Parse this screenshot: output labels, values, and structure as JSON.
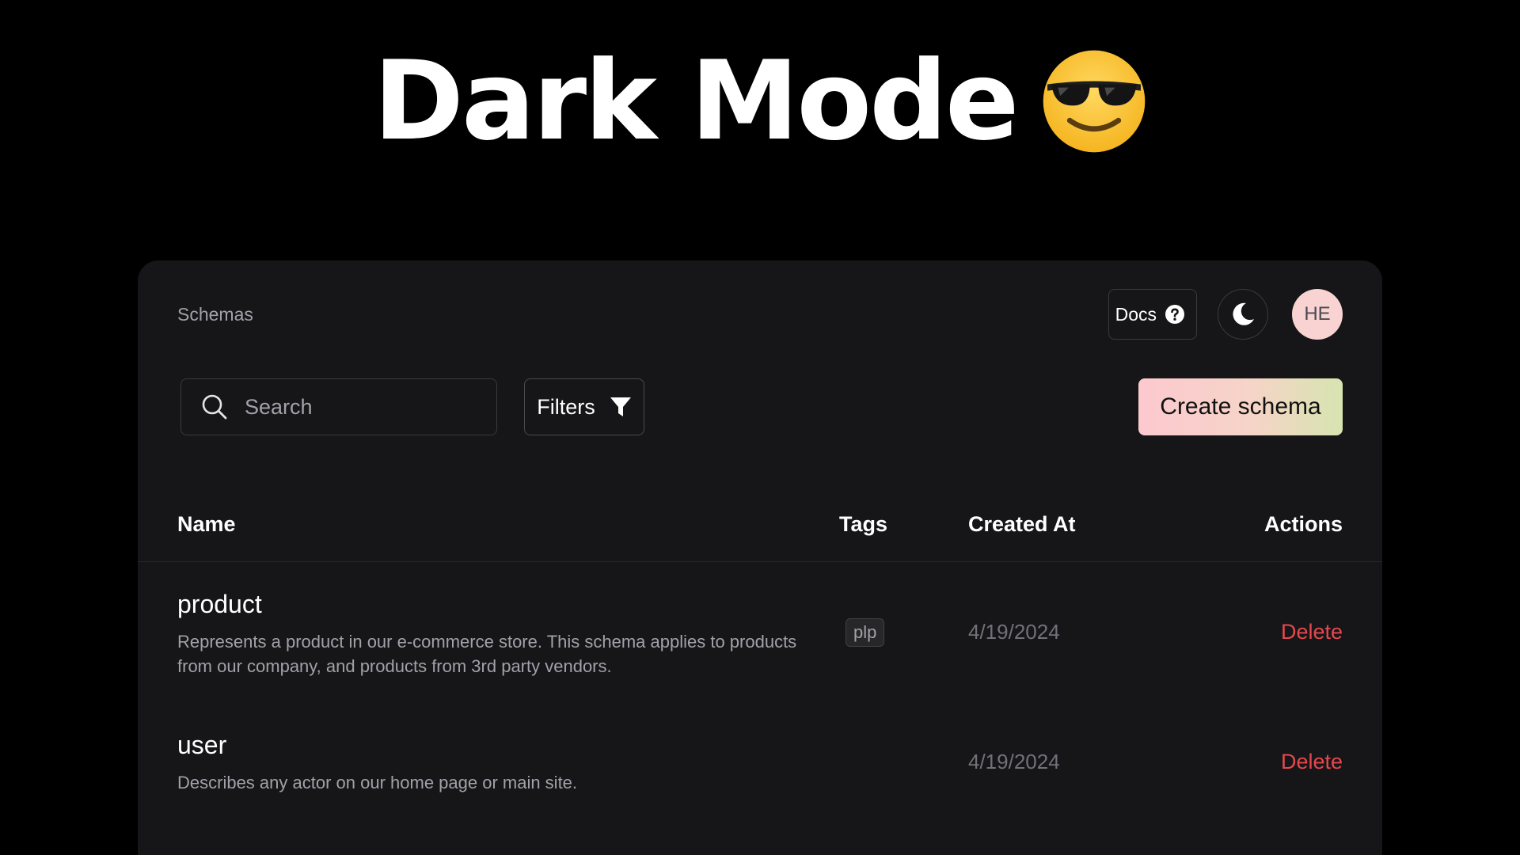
{
  "hero": {
    "title": "Dark Mode",
    "emoji_icon": "smiling-face-with-sunglasses-icon"
  },
  "header": {
    "breadcrumb": "Schemas",
    "docs_label": "Docs",
    "docs_icon": "question-circle-icon",
    "theme_toggle_icon": "moon-icon",
    "avatar_initials": "HE"
  },
  "toolbar": {
    "search_placeholder": "Search",
    "search_value": "",
    "search_icon": "search-icon",
    "filters_label": "Filters",
    "filters_icon": "funnel-icon",
    "create_label": "Create schema"
  },
  "table": {
    "columns": [
      "Name",
      "Tags",
      "Created At",
      "Actions"
    ],
    "rows": [
      {
        "name": "product",
        "description": "Represents a product in our e-commerce store. This schema applies to products from our company, and products from 3rd party vendors.",
        "tags": [
          "plp"
        ],
        "created_at": "4/19/2024",
        "action_label": "Delete"
      },
      {
        "name": "user",
        "description": "Describes any actor on our home page or main site.",
        "tags": [],
        "created_at": "4/19/2024",
        "action_label": "Delete"
      }
    ]
  },
  "colors": {
    "page_background": "#000000",
    "card_background": "#161618",
    "border": "#3a3a3e",
    "muted_text": "#a1a1aa",
    "date_text": "#71717a",
    "danger": "#e5484d",
    "avatar_background": "#f9d2d2",
    "create_gradient_start": "#fcc9cf",
    "create_gradient_end": "#d7e4b0"
  }
}
